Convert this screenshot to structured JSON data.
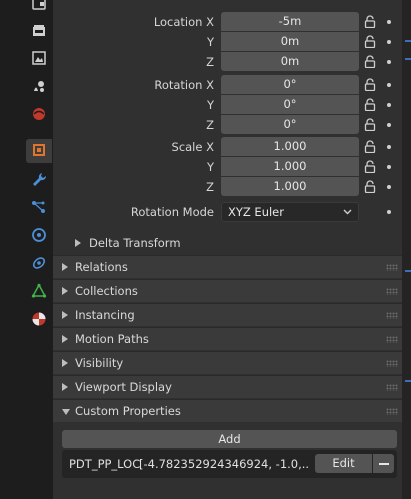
{
  "tabs": [
    {
      "icon": "tool-icon"
    },
    {
      "icon": "render-icon"
    },
    {
      "icon": "output-icon"
    },
    {
      "icon": "view-layer-icon"
    },
    {
      "icon": "scene-icon"
    },
    {
      "icon": "world-icon"
    },
    {
      "icon": "object-icon",
      "active": true
    },
    {
      "icon": "modifier-wrench-icon"
    },
    {
      "icon": "particles-icon"
    },
    {
      "icon": "physics-icon"
    },
    {
      "icon": "constraints-icon"
    },
    {
      "icon": "object-data-icon"
    },
    {
      "icon": "material-icon"
    }
  ],
  "transform": {
    "location": {
      "label_x": "Location X",
      "label_y": "Y",
      "label_z": "Z",
      "x": "-5m",
      "y": "0m",
      "z": "0m"
    },
    "rotation": {
      "label_x": "Rotation X",
      "label_y": "Y",
      "label_z": "Z",
      "x": "0°",
      "y": "0°",
      "z": "0°"
    },
    "scale": {
      "label_x": "Scale X",
      "label_y": "Y",
      "label_z": "Z",
      "x": "1.000",
      "y": "1.000",
      "z": "1.000"
    },
    "rotation_mode": {
      "label": "Rotation Mode",
      "value": "XYZ Euler"
    },
    "delta_transform": "Delta Transform"
  },
  "sections": [
    "Relations",
    "Collections",
    "Instancing",
    "Motion Paths",
    "Visibility",
    "Viewport Display",
    "Custom Properties"
  ],
  "custom_properties": {
    "add_label": "Add",
    "prop_name": "PDT_PP_LOC",
    "prop_value": "[-4.782352924346924, -1.0,...",
    "edit_label": "Edit"
  },
  "colors": {
    "accent_active_tab": "#e2752e",
    "field_bg": "#545454",
    "panel_bg": "#303030",
    "section_bg": "#3a3a3a"
  }
}
